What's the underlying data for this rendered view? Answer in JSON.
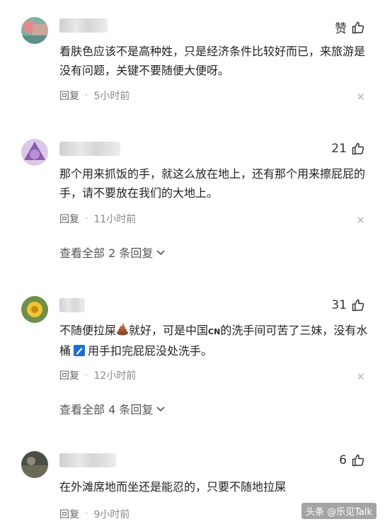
{
  "comments": [
    {
      "like_label": "赞",
      "text": "看肤色应该不是高种姓，只是经济条件比较好而已，来旅游是没有问题，关键不要随便大便呀。",
      "reply_label": "回复",
      "time": "5小时前"
    },
    {
      "like_label": "21",
      "text": "那个用来抓饭的手，就这么放在地上，还有那个用来擦屁屁的手，请不要放在我们的大地上。",
      "reply_label": "回复",
      "time": "11小时前",
      "view_replies": "查看全部 2 条回复"
    },
    {
      "like_label": "31",
      "text_part1": "不随便拉屎",
      "text_part2": "就好，可是中国",
      "text_part3": "CN",
      "text_part4": "的洗手间可苦了三妹，没有水桶",
      "text_part5": "用手扣完屁屁没处洗手。",
      "reply_label": "回复",
      "time": "12小时前",
      "view_replies": "查看全部 4 条回复"
    },
    {
      "like_label": "6",
      "text": "在外滩席地而坐还是能忍的，只要不随地拉屎",
      "reply_label": "回复",
      "time": "9小时前"
    }
  ],
  "watermark": "头条 @乐见Talk",
  "icons": {
    "like": "thumbs-up-icon",
    "close": "close-icon",
    "chevron": "chevron-down-icon",
    "poop": "poop-emoji",
    "bucket": "bucket-emoji"
  }
}
